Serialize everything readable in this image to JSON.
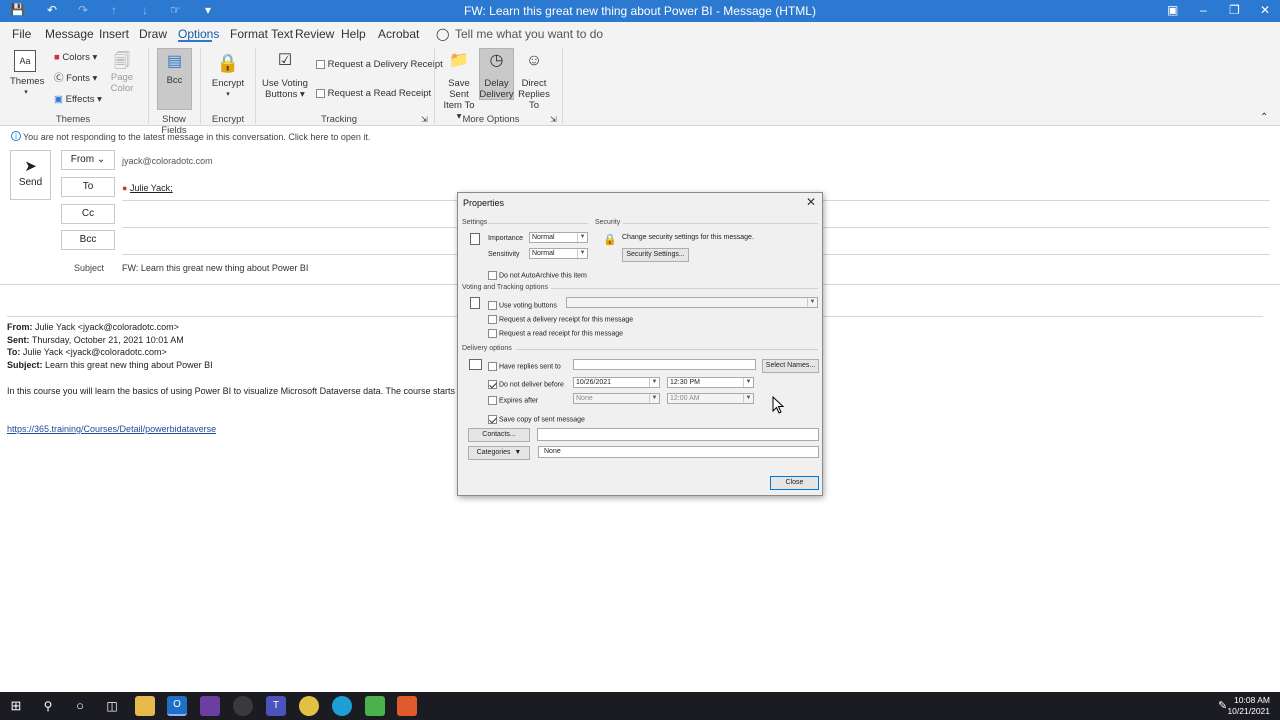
{
  "window": {
    "title": "FW: Learn this great new thing about Power BI  -  Message (HTML)"
  },
  "menu": {
    "tabs": [
      "File",
      "Message",
      "Insert",
      "Draw",
      "Options",
      "Format Text",
      "Review",
      "Help",
      "Acrobat"
    ],
    "tell_me": "Tell me what you want to do"
  },
  "ribbon": {
    "themes": {
      "themes": "Themes",
      "colors": "Colors",
      "fonts": "Fonts",
      "effects": "Effects",
      "page_color_1": "Page",
      "page_color_2": "Color",
      "group": "Themes"
    },
    "show_fields": {
      "bcc": "Bcc",
      "group": "Show Fields"
    },
    "encrypt": {
      "encrypt": "Encrypt",
      "group": "Encrypt"
    },
    "tracking": {
      "voting_1": "Use Voting",
      "voting_2": "Buttons",
      "delivery_receipt": "Request a Delivery Receipt",
      "read_receipt": "Request a Read Receipt",
      "group": "Tracking"
    },
    "more": {
      "save_sent_1": "Save Sent",
      "save_sent_2": "Item To",
      "delay_1": "Delay",
      "delay_2": "Delivery",
      "direct_1": "Direct",
      "direct_2": "Replies To",
      "group": "More Options"
    }
  },
  "info_bar": "You are not responding to the latest message in this conversation. Click here to open it.",
  "compose": {
    "send": "Send",
    "from_label": "From",
    "from_value": "jyack@coloradotc.com",
    "to_label": "To",
    "to_value": "Julie Yack;",
    "cc_label": "Cc",
    "bcc_label": "Bcc",
    "subject_label": "Subject",
    "subject_value": "FW: Learn this great new thing about Power BI"
  },
  "body": {
    "from_label": "From:",
    "from_value": "Julie Yack <jyack@coloradotc.com>",
    "sent_label": "Sent:",
    "sent_value": "Thursday, October 21, 2021 10:01 AM",
    "to_label": "To:",
    "to_value": "Julie Yack <jyack@coloradotc.com>",
    "subject_label": "Subject:",
    "subject_value": "Learn this great new thing about Power BI",
    "paragraph": "In this course you will learn the basics of using Power BI to visualize Microsoft Dataverse data. The course starts w",
    "link": "https://365.training/Courses/Detail/powerbidataverse"
  },
  "dialog": {
    "title": "Properties",
    "settings": "Settings",
    "importance_label": "Importance",
    "importance_value": "Normal",
    "sensitivity_label": "Sensitivity",
    "sensitivity_value": "Normal",
    "security": "Security",
    "security_text": "Change security settings for this message.",
    "security_button": "Security Settings...",
    "autoarchive": "Do not AutoArchive this item",
    "voting_section": "Voting and Tracking options",
    "use_voting": "Use voting buttons",
    "delivery_receipt": "Request a delivery receipt for this message",
    "read_receipt": "Request a read receipt for this message",
    "delivery_section": "Delivery options",
    "replies_to": "Have replies sent to",
    "select_names": "Select Names...",
    "deliver_before": "Do not deliver before",
    "deliver_date": "10/26/2021",
    "deliver_time": "12:30 PM",
    "expires_after": "Expires after",
    "expires_date": "None",
    "expires_time": "12:00 AM",
    "save_copy": "Save copy of sent message",
    "contacts": "Contacts...",
    "categories": "Categories",
    "categories_value": "None",
    "close": "Close"
  },
  "taskbar": {
    "time": "10:08 AM",
    "date": "10/21/2021"
  },
  "colors": {
    "accent": "#2b79d0",
    "taskbar": "#1b1b22"
  }
}
